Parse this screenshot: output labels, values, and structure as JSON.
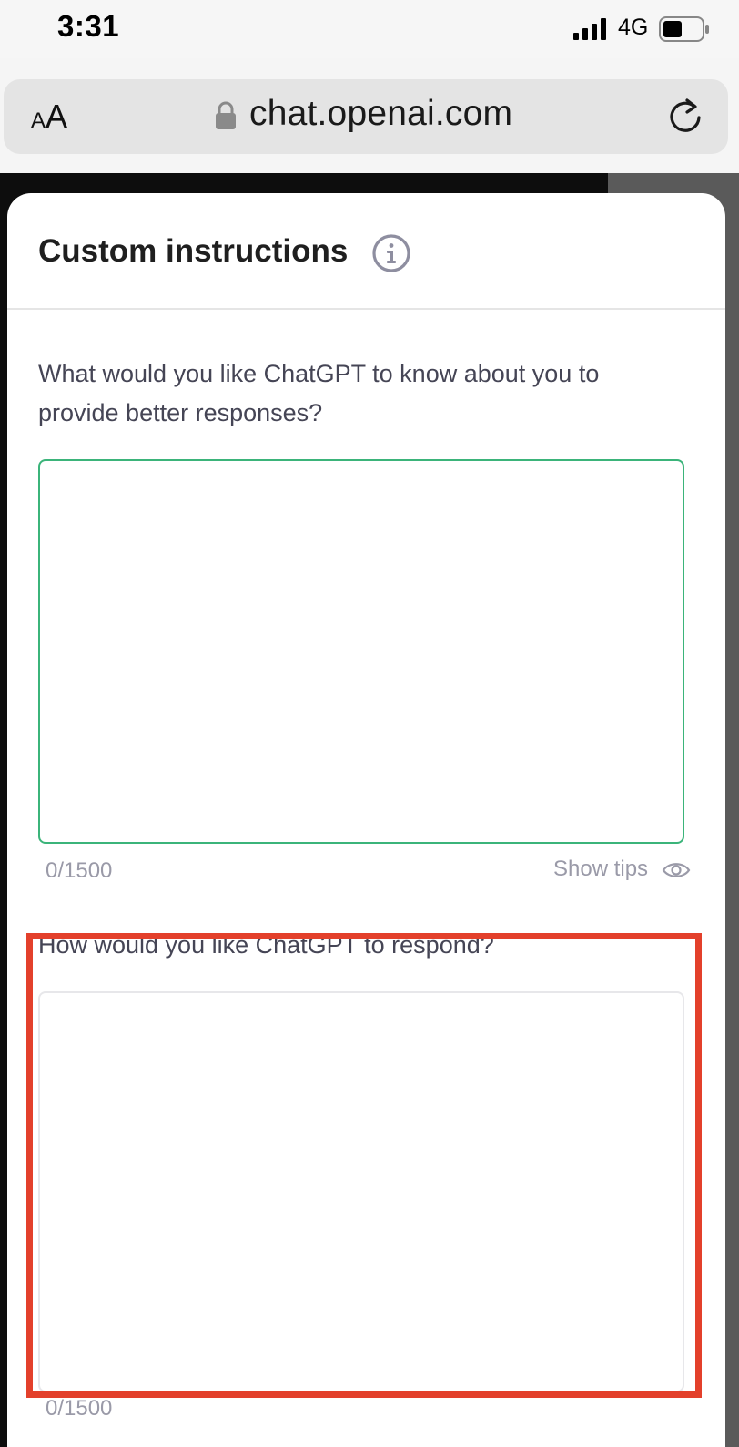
{
  "status_bar": {
    "time": "3:31",
    "network": "4G",
    "signal_icon": "cellular-signal-icon",
    "battery_icon": "battery-icon",
    "battery_level": 0.5
  },
  "address_bar": {
    "text_size_small": "A",
    "text_size_large": "A",
    "url": "chat.openai.com",
    "lock_icon": "lock-icon",
    "reload_icon": "reload-icon"
  },
  "modal": {
    "title": "Custom instructions",
    "info_icon": "info-icon",
    "fields": [
      {
        "question": "What would you like ChatGPT to know about you to provide better responses?",
        "value": "",
        "counter": "0/1500",
        "focused": true,
        "show_tips_label": "Show tips",
        "show_tips_icon": "eye-icon"
      },
      {
        "question": "How would you like ChatGPT to respond?",
        "value": "",
        "counter": "0/1500",
        "focused": false
      }
    ]
  },
  "colors": {
    "focus_border": "#3bb47a",
    "highlight": "#e3402b",
    "muted_text": "#9a9aa8",
    "body_text": "#454555"
  }
}
